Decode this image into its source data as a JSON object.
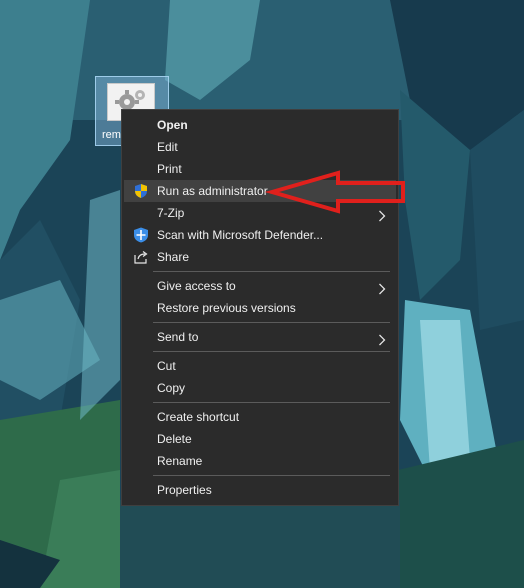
{
  "desktop": {
    "file": {
      "name": "rem",
      "icon": "gear-file-icon"
    }
  },
  "context_menu": {
    "groups": [
      [
        {
          "label": "Open",
          "bold": true
        },
        {
          "label": "Edit"
        },
        {
          "label": "Print"
        },
        {
          "label": "Run as administrator",
          "icon": "uac-shield-icon",
          "highlighted": true
        },
        {
          "label": "7-Zip",
          "submenu": true
        },
        {
          "label": "Scan with Microsoft Defender...",
          "icon": "defender-shield-icon"
        },
        {
          "label": "Share",
          "icon": "share-icon"
        }
      ],
      [
        {
          "label": "Give access to",
          "submenu": true
        },
        {
          "label": "Restore previous versions"
        }
      ],
      [
        {
          "label": "Send to",
          "submenu": true
        }
      ],
      [
        {
          "label": "Cut"
        },
        {
          "label": "Copy"
        }
      ],
      [
        {
          "label": "Create shortcut"
        },
        {
          "label": "Delete"
        },
        {
          "label": "Rename"
        }
      ],
      [
        {
          "label": "Properties"
        }
      ]
    ]
  },
  "annotation": {
    "color": "#e0201c",
    "points_to": "Run as administrator"
  }
}
